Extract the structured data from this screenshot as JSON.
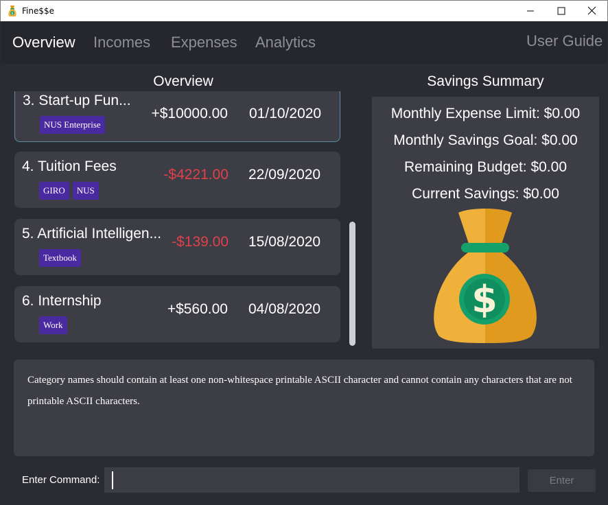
{
  "window": {
    "title": "Fine$$e",
    "minimize_glyph": "—",
    "maximize_glyph": "☐",
    "close_glyph": "✕"
  },
  "tabs": [
    {
      "label": "Overview",
      "active": true
    },
    {
      "label": "Incomes",
      "active": false
    },
    {
      "label": "Expenses",
      "active": false
    },
    {
      "label": "Analytics",
      "active": false
    }
  ],
  "user_guide_label": "User Guide",
  "overview": {
    "title": "Overview",
    "transactions": [
      {
        "title": "3. Start-up Fun...",
        "amount": "+$10000.00",
        "date": "01/10/2020",
        "tags": [
          "NUS Enterprise"
        ],
        "type": "income",
        "selected": true
      },
      {
        "title": "4. Tuition Fees",
        "amount": "-$4221.00",
        "date": "22/09/2020",
        "tags": [
          "GIRO",
          "NUS"
        ],
        "type": "expense",
        "selected": false
      },
      {
        "title": "5. Artificial Intelligen...",
        "amount": "-$139.00",
        "date": "15/08/2020",
        "tags": [
          "Textbook"
        ],
        "type": "expense",
        "selected": false
      },
      {
        "title": "6. Internship",
        "amount": "+$560.00",
        "date": "04/08/2020",
        "tags": [
          "Work"
        ],
        "type": "income",
        "selected": false
      }
    ]
  },
  "savings": {
    "title": "Savings Summary",
    "lines": [
      "Monthly Expense Limit: $0.00",
      "Monthly Savings Goal: $0.00",
      "Remaining Budget: $0.00",
      "Current Savings: $0.00"
    ],
    "icon": "money-bag-icon",
    "colors": {
      "bag": "#f0b13a",
      "bag_shadow": "#e09a1e",
      "band": "#16a06a",
      "coin": "#13a06b",
      "dollar": "#f7f1d5"
    }
  },
  "result": {
    "text": "Category names should contain at least one non-whitespace printable ASCII character and cannot contain any characters that are not printable ASCII characters."
  },
  "command": {
    "label": "Enter Command:",
    "value": "",
    "enter_label": "Enter"
  },
  "colors": {
    "background": "#2b2c33",
    "card": "#3c3d45",
    "tag": "#4a2aa0",
    "negative": "#e0414b",
    "selected_border": "#5a8fa6"
  }
}
